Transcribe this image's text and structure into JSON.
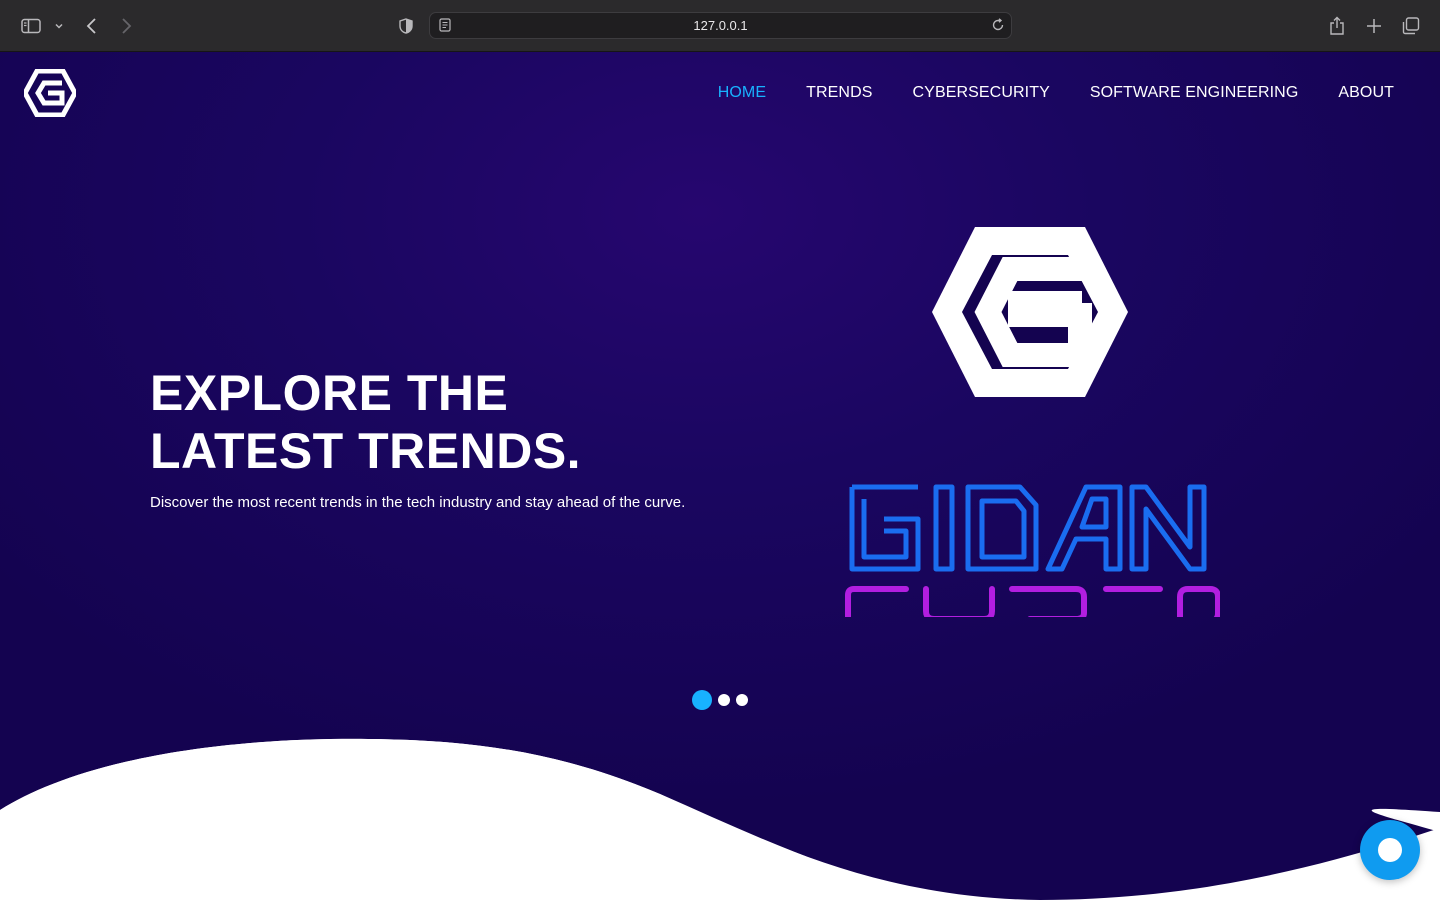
{
  "browser": {
    "url": "127.0.0.1",
    "icons": [
      "sidebar-icon",
      "chevron-down-icon",
      "back-icon",
      "forward-icon",
      "shield-icon",
      "reader-icon",
      "reload-icon",
      "share-icon",
      "new-tab-icon",
      "tabs-overview-icon"
    ]
  },
  "nav": {
    "items": [
      {
        "label": "HOME",
        "active": true
      },
      {
        "label": "TRENDS",
        "active": false
      },
      {
        "label": "CYBERSECURITY",
        "active": false
      },
      {
        "label": "SOFTWARE ENGINEERING",
        "active": false
      },
      {
        "label": "ABOUT",
        "active": false
      }
    ]
  },
  "hero": {
    "headline": "EXPLORE THE LATEST TRENDS.",
    "subtitle": "Discover the most recent trends in the tech industry and stay ahead of the curve.",
    "brand_line1": "GIDAN",
    "brand_line2": "CYBER"
  },
  "carousel": {
    "slides": 3,
    "active_index": 0
  },
  "colors": {
    "hero_bg": "#1a0660",
    "accent": "#18b2ff",
    "brand_blue": "#1a6df0",
    "brand_purple": "#b21ee0",
    "chat_button": "#0f9bf0"
  }
}
